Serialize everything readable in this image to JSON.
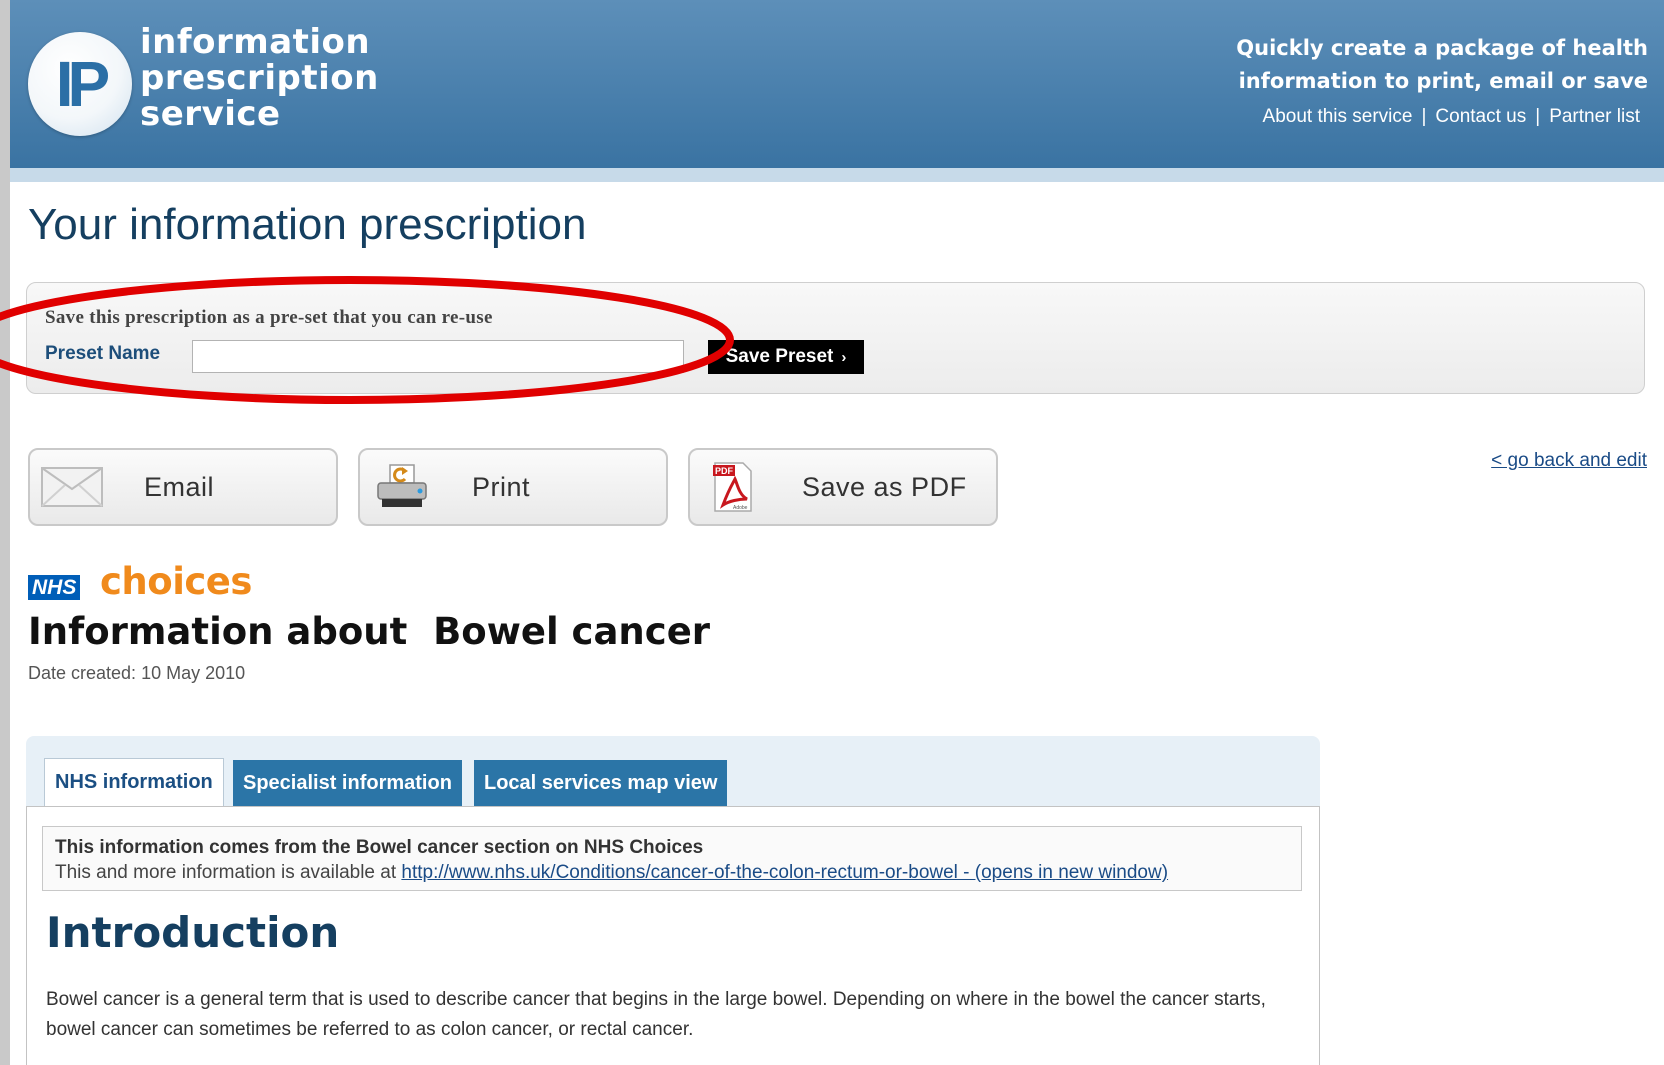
{
  "header": {
    "logo_mark": "IP",
    "logo_lines": [
      "information",
      "prescription",
      "service"
    ],
    "tagline_lines": [
      "Quickly create a package of health",
      "information to print, email or save"
    ],
    "links": [
      "About this service",
      "Contact us",
      "Partner list"
    ],
    "link_separator": "|"
  },
  "page": {
    "title": "Your information prescription"
  },
  "preset": {
    "hint": "Save this prescription as a pre-set that you can re-use",
    "label": "Preset Name",
    "input_value": "",
    "save_label": "Save Preset",
    "save_chevron": "›"
  },
  "actions": [
    {
      "label": "Email",
      "icon": "envelope-icon"
    },
    {
      "label": "Print",
      "icon": "printer-icon"
    },
    {
      "label": "Save as PDF",
      "icon": "pdf-icon"
    }
  ],
  "go_back": "< go back and edit",
  "nhs": {
    "nhs_logo": "NHS",
    "choices_logo": "choices",
    "title": "Information about  Bowel cancer",
    "date_created": "Date created: 10 May 2010"
  },
  "tabs": [
    {
      "label": "NHS information",
      "active": true
    },
    {
      "label": "Specialist information",
      "active": false
    },
    {
      "label": "Local services map view",
      "active": false
    }
  ],
  "source": {
    "line1": "This information comes from the Bowel cancer section on NHS Choices",
    "line2_prefix": "This and more information is available at ",
    "link_text": "http://www.nhs.uk/Conditions/cancer-of-the-colon-rectum-or-bowel - (opens in new window)"
  },
  "content": {
    "heading": "Introduction",
    "paragraph": "Bowel cancer is a general term that is used to describe cancer that begins in the large bowel. Depending on where in the bowel the cancer starts, bowel cancer can sometimes be referred to as colon cancer, or rectal cancer."
  },
  "colors": {
    "header_blue": "#3a73a2",
    "title_blue": "#153f60",
    "tab_blue": "#2b75a7",
    "annotation_red": "#e00000",
    "choices_orange": "#f08a1c",
    "nhs_blue": "#005eb8"
  }
}
